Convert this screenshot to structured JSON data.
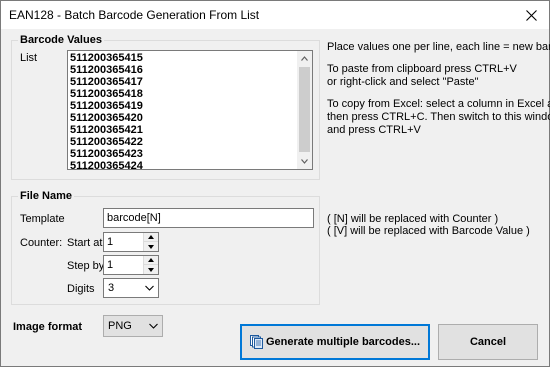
{
  "window": {
    "title": "EAN128 - Batch Barcode Generation From List"
  },
  "barcode_values": {
    "group_title": "Barcode Values",
    "list_label": "List",
    "values": [
      "511200365415",
      "511200365416",
      "511200365417",
      "511200365418",
      "511200365419",
      "511200365420",
      "511200365421",
      "511200365422",
      "511200365423",
      "511200365424"
    ],
    "help": [
      "Place values one per line, each line = new barcode",
      "To paste from clipboard press CTRL+V",
      "or right-click and select \"Paste\"",
      "To copy from Excel: select a column in Excel and",
      "then press CTRL+C. Then switch to this window",
      "and press CTRL+V"
    ]
  },
  "file_name": {
    "group_title": "File Name",
    "template_label": "Template",
    "template_value": "barcode[N]",
    "counter_label": "Counter:",
    "start_at_label": "Start at",
    "start_at_value": "1",
    "step_by_label": "Step by",
    "step_by_value": "1",
    "digits_label": "Digits",
    "digits_value": "3",
    "hint_n": "( [N] will be replaced with Counter )",
    "hint_v": "( [V] will be replaced with Barcode Value )"
  },
  "image_format": {
    "label": "Image format",
    "value": "PNG"
  },
  "buttons": {
    "generate": "Generate multiple barcodes...",
    "cancel": "Cancel"
  },
  "icons": {
    "close": "close-icon",
    "generate": "document-stack-icon"
  }
}
